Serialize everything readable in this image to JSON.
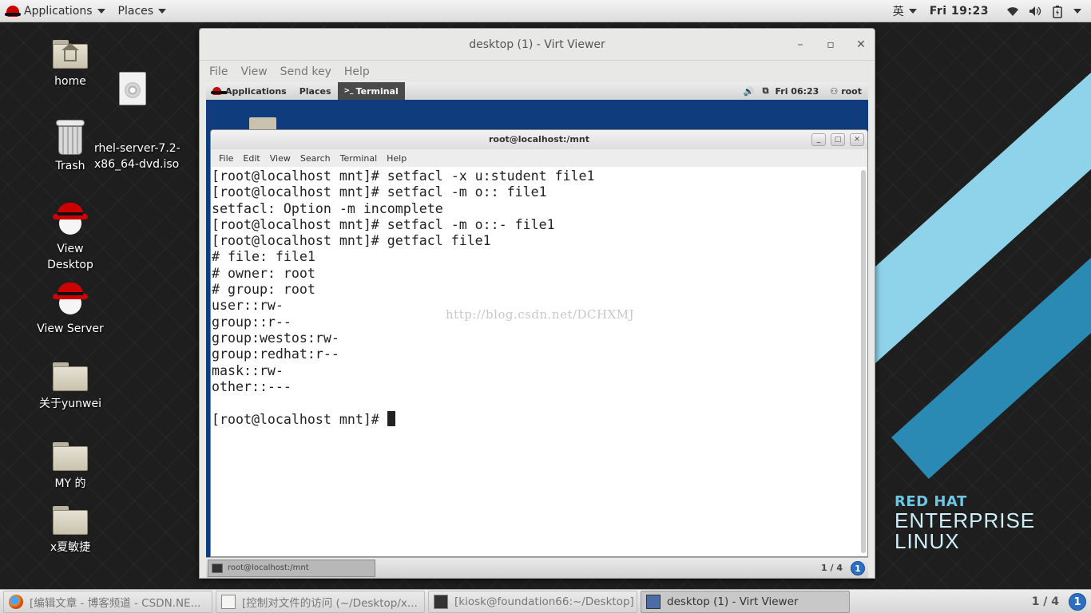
{
  "host_topbar": {
    "applications": "Applications",
    "places": "Places",
    "input_method": "英",
    "clock": "Fri 19:23"
  },
  "desktop_icons": [
    {
      "label": "home"
    },
    {
      "label": "rhel-server-7.2-\nx86_64-dvd.iso"
    },
    {
      "label": "Trash"
    },
    {
      "label": "View Desktop"
    },
    {
      "label": "View Server"
    },
    {
      "label": "关于yunwei"
    },
    {
      "label": "MY 的"
    },
    {
      "label": "x夏敏捷"
    }
  ],
  "virt_viewer": {
    "title": "desktop (1) - Virt Viewer",
    "menu": [
      "File",
      "View",
      "Send key",
      "Help"
    ]
  },
  "guest": {
    "topbar": {
      "applications": "Applications",
      "places": "Places",
      "terminal": "Terminal",
      "clock": "Fri 06:23",
      "user": "root"
    },
    "terminal": {
      "title": "root@localhost:/mnt",
      "menu": [
        "File",
        "Edit",
        "View",
        "Search",
        "Terminal",
        "Help"
      ],
      "lines": [
        "[root@localhost mnt]# setfacl -x u:student file1",
        "[root@localhost mnt]# setfacl -m o:: file1",
        "setfacl: Option -m incomplete",
        "[root@localhost mnt]# setfacl -m o::- file1",
        "[root@localhost mnt]# getfacl file1",
        "# file: file1",
        "# owner: root",
        "# group: root",
        "user::rw-",
        "group::r--",
        "group:westos:rw-",
        "group:redhat:r--",
        "mask::rw-",
        "other::---",
        "",
        "[root@localhost mnt]# "
      ],
      "watermark": "http://blog.csdn.net/DCHXMJ"
    },
    "bottom": {
      "task_label": "root@localhost:/mnt",
      "pager": "1 / 4",
      "info": "1"
    }
  },
  "brand": {
    "line1": "RED HAT",
    "line2": "ENTERPRISE",
    "line3": "LINUX"
  },
  "taskbar": {
    "tasks": [
      {
        "label": "[编辑文章 - 博客频道 - CSDN.NE...",
        "icon": "firefox-icon"
      },
      {
        "label": "[控制对文件的访问 (~/Desktop/x...",
        "icon": "text-editor-icon"
      },
      {
        "label": "[kiosk@foundation66:~/Desktop]",
        "icon": "terminal-icon"
      },
      {
        "label": "desktop (1) - Virt Viewer",
        "icon": "virt-viewer-icon"
      }
    ],
    "pager": "1 / 4",
    "info": "1"
  }
}
